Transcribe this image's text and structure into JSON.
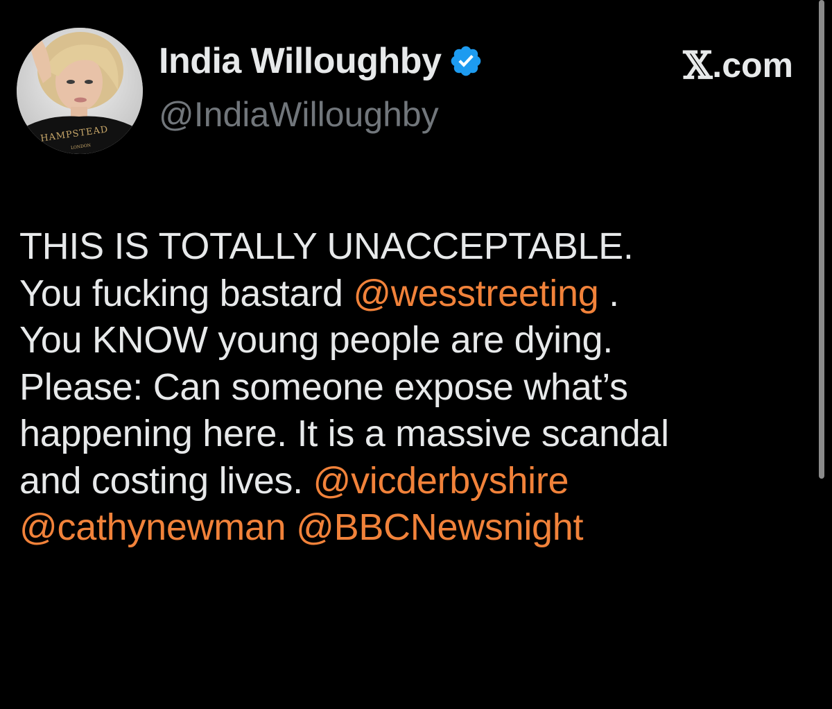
{
  "author": {
    "display_name": "India Willoughby",
    "handle": "@IndiaWilloughby",
    "verified_icon": "verified-badge-icon",
    "avatar_shirt_text": "HAMPSTEAD",
    "avatar_shirt_subtext": "LONDON"
  },
  "brand": {
    "x_mark": "𝕏",
    "rest": ".com"
  },
  "tweet": {
    "lines": [
      {
        "parts": [
          {
            "text": "THIS IS TOTALLY UNACCEPTABLE.",
            "mention": false
          }
        ]
      },
      {
        "parts": [
          {
            "text": "You fucking bastard ",
            "mention": false
          },
          {
            "text": "@wesstreeting",
            "mention": true
          },
          {
            "text": " .",
            "mention": false
          }
        ]
      },
      {
        "parts": [
          {
            "text": "You KNOW young people are dying.",
            "mention": false
          }
        ]
      },
      {
        "parts": [
          {
            "text": "Please: Can someone expose what’s",
            "mention": false
          }
        ]
      },
      {
        "parts": [
          {
            "text": "happening here. It is a massive scandal",
            "mention": false
          }
        ]
      },
      {
        "parts": [
          {
            "text": "and costing lives. ",
            "mention": false
          },
          {
            "text": "@vicderbyshire",
            "mention": true
          }
        ]
      },
      {
        "parts": [
          {
            "text": "@cathynewman",
            "mention": true
          },
          {
            "text": " ",
            "mention": false
          },
          {
            "text": "@BBCNewsnight",
            "mention": true
          }
        ]
      }
    ]
  },
  "colors": {
    "background": "#000000",
    "text": "#e7e9ea",
    "secondary_text": "#71767b",
    "mention": "#f1823a",
    "verified_badge": "#1d9bf0"
  }
}
